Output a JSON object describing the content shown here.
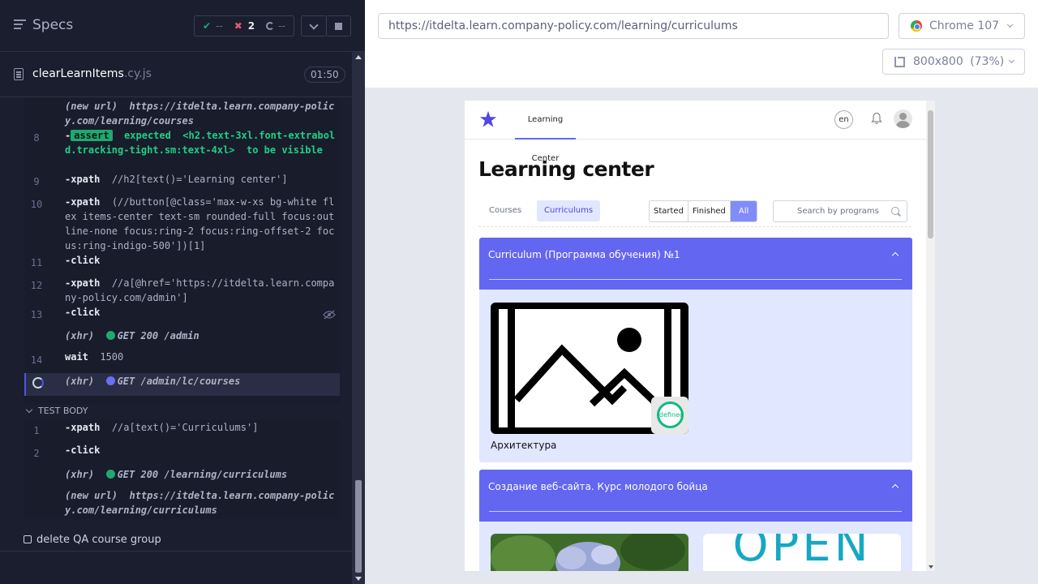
{
  "reporter": {
    "title": "Specs",
    "stats": {
      "passed": "--",
      "failed": "2",
      "pending": "--"
    },
    "spec": {
      "name": "clearLearnItems",
      "ext": ".cy.js",
      "time": "01:50"
    },
    "commands": [
      {
        "line": "",
        "text_prefix": "(new url)",
        "text": "https://itdelta.learn.company-policy.com/learning/courses"
      },
      {
        "line": "8",
        "name": "-",
        "tag": "assert",
        "text": "expected",
        "code": "<h2.text-3xl.font-extrabold.tracking-tight.sm:text-4xl>",
        "suffix": "to be",
        "suffix2": "visible"
      },
      {
        "line": "9",
        "name": "-xpath",
        "text": "//h2[text()='Learning center']"
      },
      {
        "line": "10",
        "name": "-xpath",
        "text": "(//button[@class='max-w-xs bg-white flex items-center text-sm rounded-full focus:outline-none focus:ring-2 focus:ring-offset-2 focus:ring-indigo-500'])[1]"
      },
      {
        "line": "11",
        "name": "-click",
        "text": ""
      },
      {
        "line": "12",
        "name": "-xpath",
        "text": "//a[@href='https://itdelta.learn.company-policy.com/admin']"
      },
      {
        "line": "13",
        "name": "-click",
        "text": ""
      },
      {
        "line": "",
        "text_prefix": "(xhr)",
        "text": "GET 200 /admin"
      },
      {
        "line": "14",
        "name": "wait",
        "text": "1500"
      },
      {
        "line": "",
        "text_prefix": "(xhr)",
        "text": "GET /admin/lc/courses"
      }
    ],
    "test_body_label": "TEST BODY",
    "body_commands": [
      {
        "line": "1",
        "name": "-xpath",
        "text": "//a[text()='Curriculums']"
      },
      {
        "line": "2",
        "name": "-click",
        "text": ""
      },
      {
        "line": "",
        "text_prefix": "(xhr)",
        "text": "GET 200 /learning/curriculums"
      },
      {
        "line": "",
        "text_prefix": "(new url)",
        "text": "https://itdelta.learn.company-policy.com/learning/curriculums"
      }
    ],
    "other_test": "delete QA course group"
  },
  "aut": {
    "url": "https://itdelta.learn.company-policy.com/learning/curriculums",
    "browser": "Chrome 107",
    "viewport": "800x800",
    "scale": "(73%)"
  },
  "app": {
    "nav_link": "Learning Center",
    "lang": "en",
    "heading": "Learning center",
    "tabs": [
      "Courses",
      "Curriculums"
    ],
    "status_filters": [
      "Started",
      "Finished",
      "All"
    ],
    "search_placeholder": "Search by programs",
    "curriculums": [
      {
        "title": "Curriculum (Программа обучения) №1",
        "courses": [
          "Архитектура"
        ],
        "badge": "defined"
      },
      {
        "title": "Создание веб-сайта. Курс молодого бойца",
        "courses": [],
        "open_text": "OPEN"
      }
    ]
  },
  "colors": {
    "accent": "#6366f1",
    "pass": "#1fa971",
    "fail": "#e45770",
    "reporter_bg": "#1b1e2e"
  }
}
